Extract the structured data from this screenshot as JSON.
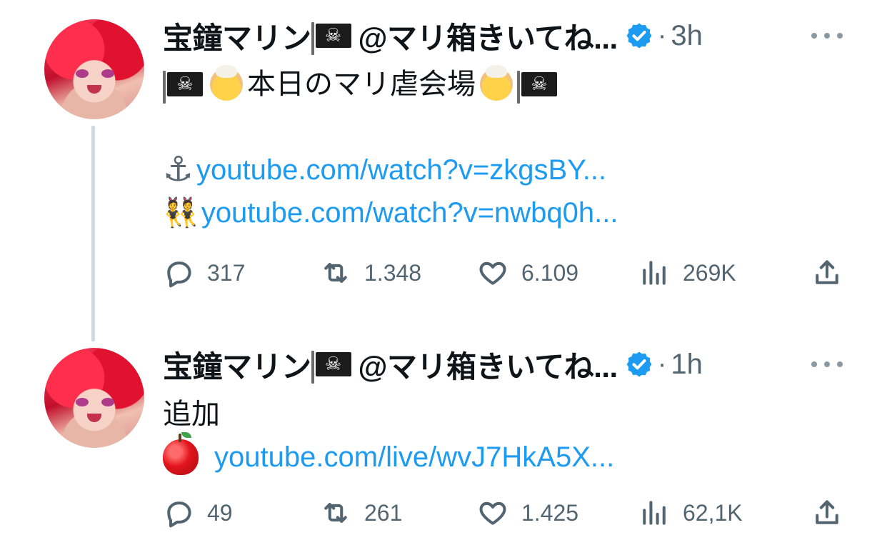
{
  "tweets": [
    {
      "display_name": "宝鐘マリン",
      "handle": "@マリ箱きいてね...",
      "time": "3h",
      "lines": {
        "title_text": "本日のマリ虐会場",
        "link1": "youtube.com/watch?v=zkgsBY...",
        "link2": "youtube.com/watch?v=nwbq0h..."
      },
      "stats": {
        "replies": "317",
        "retweets": "1.348",
        "likes": "6.109",
        "views": "269K"
      }
    },
    {
      "display_name": "宝鐘マリン",
      "handle": "@マリ箱きいてね...",
      "time": "1h",
      "lines": {
        "text": "追加",
        "link": "youtube.com/live/wvJ7HkA5X..."
      },
      "stats": {
        "replies": "49",
        "retweets": "261",
        "likes": "1.425",
        "views": "62,1K"
      }
    }
  ],
  "icons": {
    "verified": "verified-badge-icon",
    "more": "more-dots-icon",
    "reply": "reply-icon",
    "retweet": "retweet-icon",
    "like": "heart-icon",
    "views": "views-icon",
    "share": "share-icon"
  },
  "colors": {
    "link": "#1d9bf0",
    "verified": "#1d9bf0",
    "muted": "#536471",
    "thread_line": "#cfd9de"
  }
}
